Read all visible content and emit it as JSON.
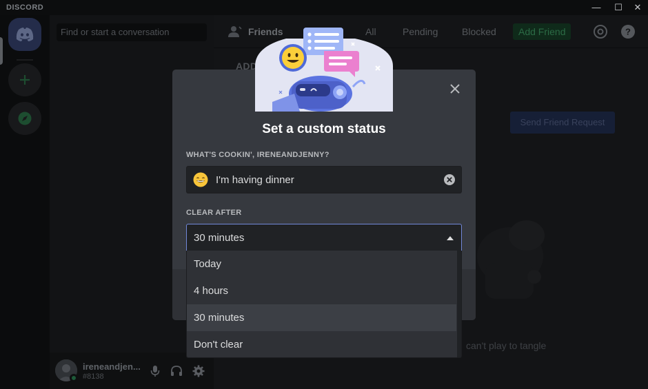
{
  "titlebar": {
    "brand": "DISCORD",
    "minimize": "—",
    "maximize": "☐",
    "close": "✕"
  },
  "sidebar": {
    "search_placeholder": "Find or start a conversation"
  },
  "user": {
    "name": "ireneandjen...",
    "tag": "#8138"
  },
  "header": {
    "friends": "Friends",
    "tabs": [
      "All",
      "Pending",
      "Blocked"
    ],
    "add_friend": "Add Friend"
  },
  "main": {
    "add_friend_title": "ADD FRIEND",
    "send_request": "Send Friend Request",
    "wumpus_note": "can't play to tangle"
  },
  "modal": {
    "title": "Set a custom status",
    "status_label": "WHAT'S COOKIN', IRENEANDJENNY?",
    "status_value": "I'm having dinner",
    "clear_label": "CLEAR AFTER",
    "clear_value": "30 minutes",
    "options": [
      "Today",
      "4 hours",
      "30 minutes",
      "Don't clear"
    ],
    "selected_option": "30 minutes"
  },
  "colors": {
    "modal_bg": "#36393f",
    "input_bg": "#202225",
    "focus_border": "#7289da",
    "blurple": "#5865f2",
    "online_green": "#3ba55d"
  },
  "icons": {
    "rail_home": "discord-logo-icon",
    "rail_add": "plus-icon",
    "rail_explore": "compass-icon",
    "header_friends": "friends-wave-icon",
    "header_mention": "at-sign-icon",
    "header_help": "help-icon",
    "user_mic": "microphone-icon",
    "user_headset": "headset-icon",
    "user_settings": "gear-icon",
    "modal_close": "close-icon",
    "status_emoji": "grinning-face-icon",
    "status_clear": "clear-circle-icon",
    "select_caret": "caret-up-icon"
  }
}
